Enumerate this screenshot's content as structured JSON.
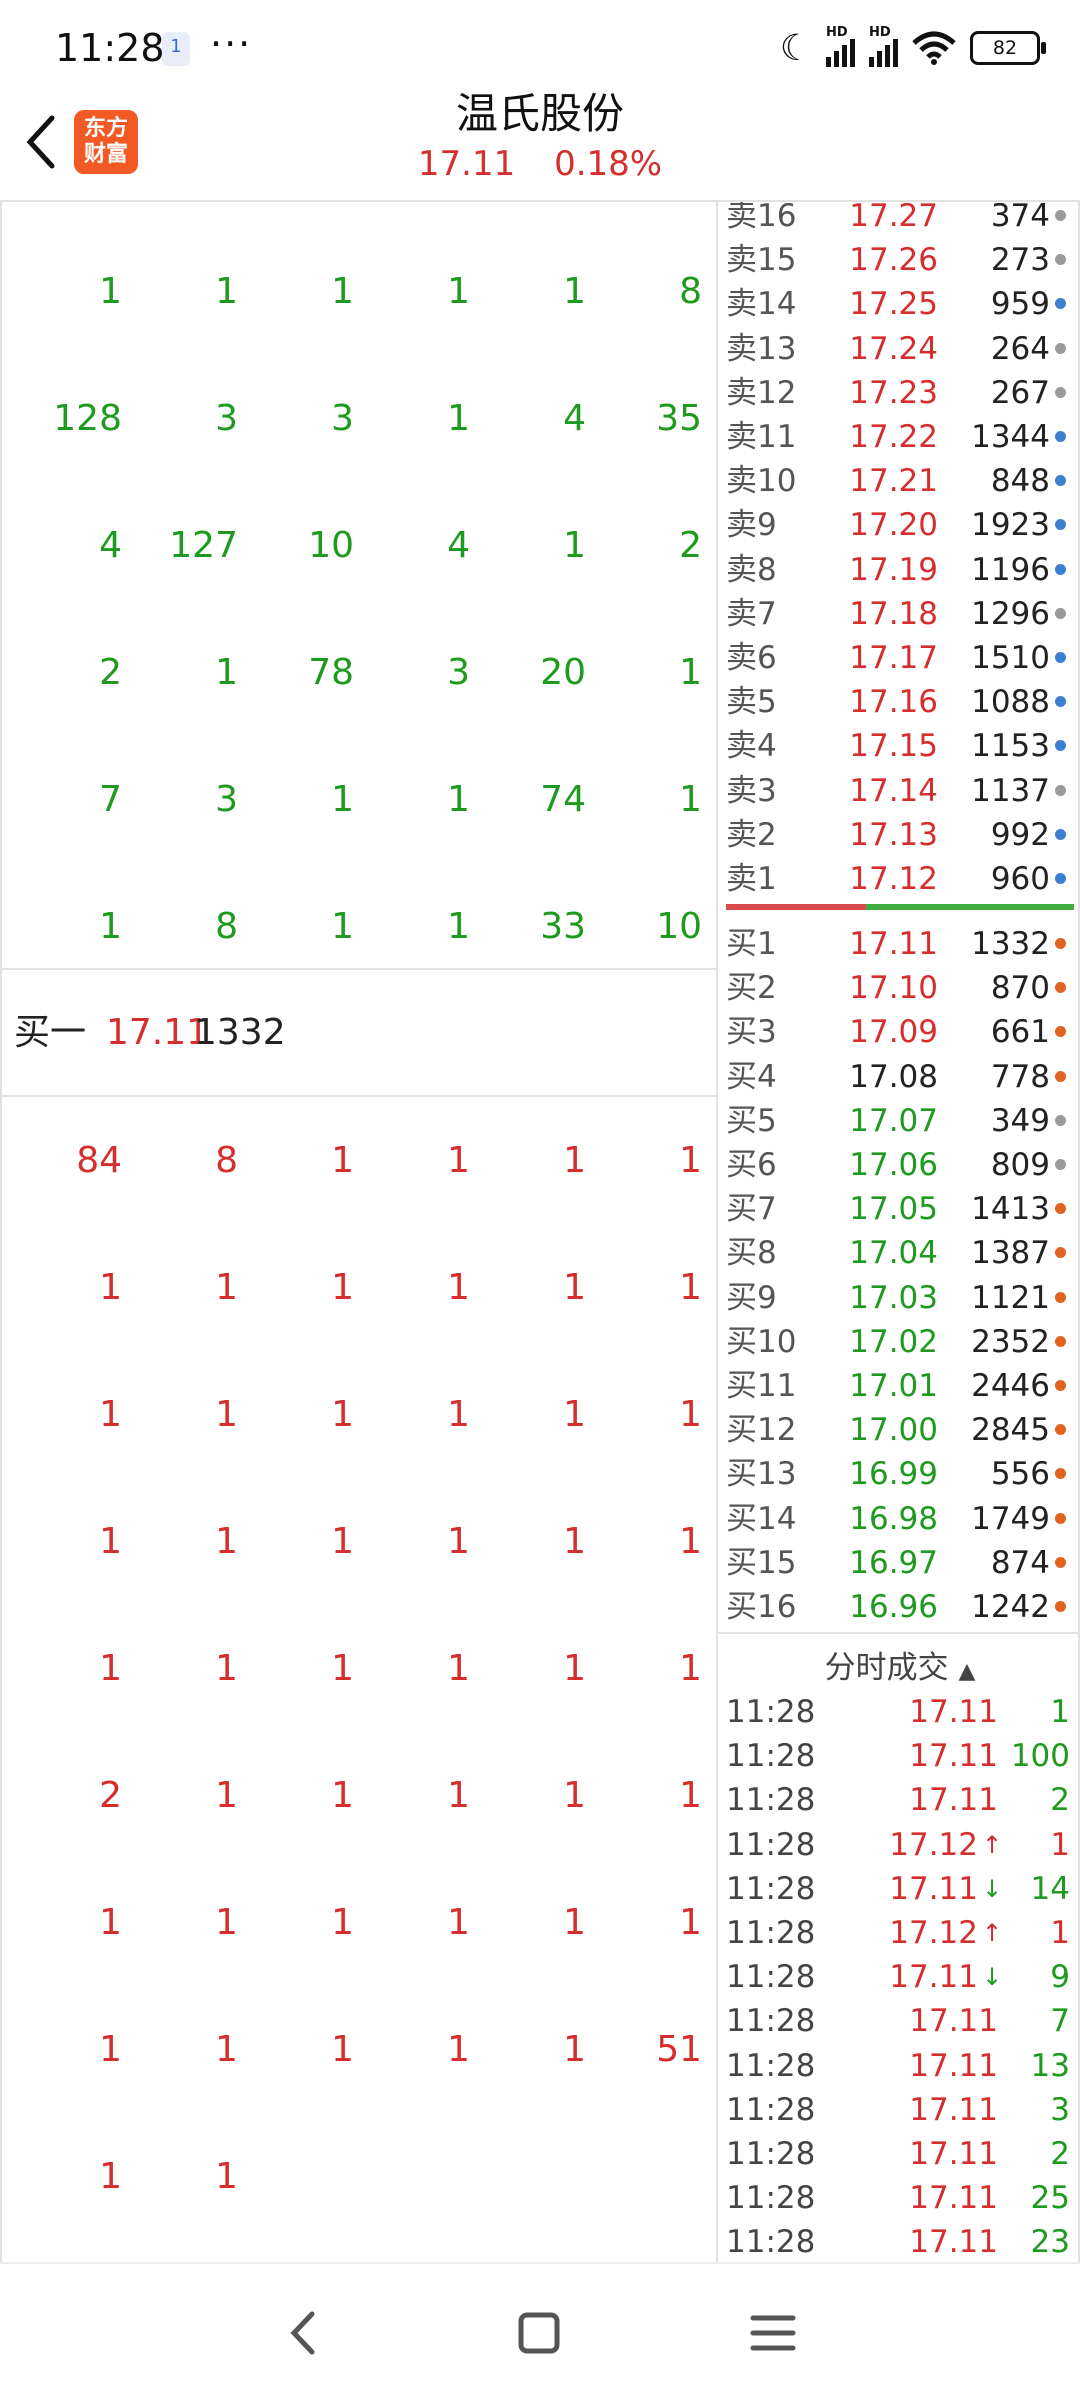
{
  "status_bar": {
    "time": "11:28",
    "notif_label": "1",
    "more": "···",
    "battery": "82",
    "hd": "HD"
  },
  "header": {
    "stock_name": "温氏股份",
    "price": "17.11",
    "change_pct": "0.18%",
    "logo_line1": "东方",
    "logo_line2": "财富"
  },
  "queue_top": [
    [
      "1",
      "1",
      "1",
      "1",
      "1",
      "8"
    ],
    [
      "128",
      "3",
      "3",
      "1",
      "4",
      "35"
    ],
    [
      "4",
      "127",
      "10",
      "4",
      "1",
      "2"
    ],
    [
      "2",
      "1",
      "78",
      "3",
      "20",
      "1"
    ],
    [
      "7",
      "3",
      "1",
      "1",
      "74",
      "1"
    ],
    [
      "1",
      "8",
      "1",
      "1",
      "33",
      "10"
    ]
  ],
  "best_bid": {
    "label": "买一",
    "price": "17.11",
    "volume": "1332"
  },
  "queue_bottom": [
    [
      "84",
      "8",
      "1",
      "1",
      "1",
      "1"
    ],
    [
      "1",
      "1",
      "1",
      "1",
      "1",
      "1"
    ],
    [
      "1",
      "1",
      "1",
      "1",
      "1",
      "1"
    ],
    [
      "1",
      "1",
      "1",
      "1",
      "1",
      "1"
    ],
    [
      "1",
      "1",
      "1",
      "1",
      "1",
      "1"
    ],
    [
      "2",
      "1",
      "1",
      "1",
      "1",
      "1"
    ],
    [
      "1",
      "1",
      "1",
      "1",
      "1",
      "1"
    ],
    [
      "1",
      "1",
      "1",
      "1",
      "1",
      "51"
    ],
    [
      "1",
      "1",
      "",
      "",
      "",
      ""
    ]
  ],
  "sell_levels": [
    {
      "level": "卖16",
      "price": "17.27",
      "volume": "374",
      "dot": "#9a9a9a"
    },
    {
      "level": "卖15",
      "price": "17.26",
      "volume": "273",
      "dot": "#9a9a9a"
    },
    {
      "level": "卖14",
      "price": "17.25",
      "volume": "959",
      "dot": "#3d7fcf"
    },
    {
      "level": "卖13",
      "price": "17.24",
      "volume": "264",
      "dot": "#9a9a9a"
    },
    {
      "level": "卖12",
      "price": "17.23",
      "volume": "267",
      "dot": "#9a9a9a"
    },
    {
      "level": "卖11",
      "price": "17.22",
      "volume": "1344",
      "dot": "#3d7fcf"
    },
    {
      "level": "卖10",
      "price": "17.21",
      "volume": "848",
      "dot": "#3d7fcf"
    },
    {
      "level": "卖9",
      "price": "17.20",
      "volume": "1923",
      "dot": "#3d7fcf"
    },
    {
      "level": "卖8",
      "price": "17.19",
      "volume": "1196",
      "dot": "#3d7fcf"
    },
    {
      "level": "卖7",
      "price": "17.18",
      "volume": "1296",
      "dot": "#9a9a9a"
    },
    {
      "level": "卖6",
      "price": "17.17",
      "volume": "1510",
      "dot": "#3d7fcf"
    },
    {
      "level": "卖5",
      "price": "17.16",
      "volume": "1088",
      "dot": "#3d7fcf"
    },
    {
      "level": "卖4",
      "price": "17.15",
      "volume": "1153",
      "dot": "#3d7fcf"
    },
    {
      "level": "卖3",
      "price": "17.14",
      "volume": "1137",
      "dot": "#9a9a9a"
    },
    {
      "level": "卖2",
      "price": "17.13",
      "volume": "992",
      "dot": "#3d7fcf"
    },
    {
      "level": "卖1",
      "price": "17.12",
      "volume": "960",
      "dot": "#3d7fcf"
    }
  ],
  "buy_levels": [
    {
      "level": "买1",
      "price": "17.11",
      "volume": "1332",
      "dot": "#e0641f",
      "color": "red"
    },
    {
      "level": "买2",
      "price": "17.10",
      "volume": "870",
      "dot": "#e0641f",
      "color": "red"
    },
    {
      "level": "买3",
      "price": "17.09",
      "volume": "661",
      "dot": "#e0641f",
      "color": "red"
    },
    {
      "level": "买4",
      "price": "17.08",
      "volume": "778",
      "dot": "#e0641f",
      "color": "black"
    },
    {
      "level": "买5",
      "price": "17.07",
      "volume": "349",
      "dot": "#9a9a9a",
      "color": "green"
    },
    {
      "level": "买6",
      "price": "17.06",
      "volume": "809",
      "dot": "#9a9a9a",
      "color": "green"
    },
    {
      "level": "买7",
      "price": "17.05",
      "volume": "1413",
      "dot": "#e0641f",
      "color": "green"
    },
    {
      "level": "买8",
      "price": "17.04",
      "volume": "1387",
      "dot": "#e0641f",
      "color": "green"
    },
    {
      "level": "买9",
      "price": "17.03",
      "volume": "1121",
      "dot": "#e0641f",
      "color": "green"
    },
    {
      "level": "买10",
      "price": "17.02",
      "volume": "2352",
      "dot": "#e0641f",
      "color": "green"
    },
    {
      "level": "买11",
      "price": "17.01",
      "volume": "2446",
      "dot": "#e0641f",
      "color": "green"
    },
    {
      "level": "买12",
      "price": "17.00",
      "volume": "2845",
      "dot": "#e0641f",
      "color": "green"
    },
    {
      "level": "买13",
      "price": "16.99",
      "volume": "556",
      "dot": "#e0641f",
      "color": "green"
    },
    {
      "level": "买14",
      "price": "16.98",
      "volume": "1749",
      "dot": "#e0641f",
      "color": "green"
    },
    {
      "level": "买15",
      "price": "16.97",
      "volume": "874",
      "dot": "#e0641f",
      "color": "green"
    },
    {
      "level": "买16",
      "price": "16.96",
      "volume": "1242",
      "dot": "#e0641f",
      "color": "green"
    }
  ],
  "ticks_title": "分时成交",
  "ticks": [
    {
      "time": "11:28",
      "price": "17.11",
      "arrow": "",
      "volume": "1",
      "vcolor": "green"
    },
    {
      "time": "11:28",
      "price": "17.11",
      "arrow": "",
      "volume": "100",
      "vcolor": "green"
    },
    {
      "time": "11:28",
      "price": "17.11",
      "arrow": "",
      "volume": "2",
      "vcolor": "green"
    },
    {
      "time": "11:28",
      "price": "17.12",
      "arrow": "↑",
      "volume": "1",
      "vcolor": "red"
    },
    {
      "time": "11:28",
      "price": "17.11",
      "arrow": "↓",
      "volume": "14",
      "vcolor": "green"
    },
    {
      "time": "11:28",
      "price": "17.12",
      "arrow": "↑",
      "volume": "1",
      "vcolor": "red"
    },
    {
      "time": "11:28",
      "price": "17.11",
      "arrow": "↓",
      "volume": "9",
      "vcolor": "green"
    },
    {
      "time": "11:28",
      "price": "17.11",
      "arrow": "",
      "volume": "7",
      "vcolor": "green"
    },
    {
      "time": "11:28",
      "price": "17.11",
      "arrow": "",
      "volume": "13",
      "vcolor": "green"
    },
    {
      "time": "11:28",
      "price": "17.11",
      "arrow": "",
      "volume": "3",
      "vcolor": "green"
    },
    {
      "time": "11:28",
      "price": "17.11",
      "arrow": "",
      "volume": "2",
      "vcolor": "green"
    },
    {
      "time": "11:28",
      "price": "17.11",
      "arrow": "",
      "volume": "25",
      "vcolor": "green"
    },
    {
      "time": "11:28",
      "price": "17.11",
      "arrow": "",
      "volume": "23",
      "vcolor": "green"
    }
  ],
  "bottom_nav": {
    "icons": [
      "back-icon",
      "home-icon",
      "menu-icon"
    ]
  }
}
